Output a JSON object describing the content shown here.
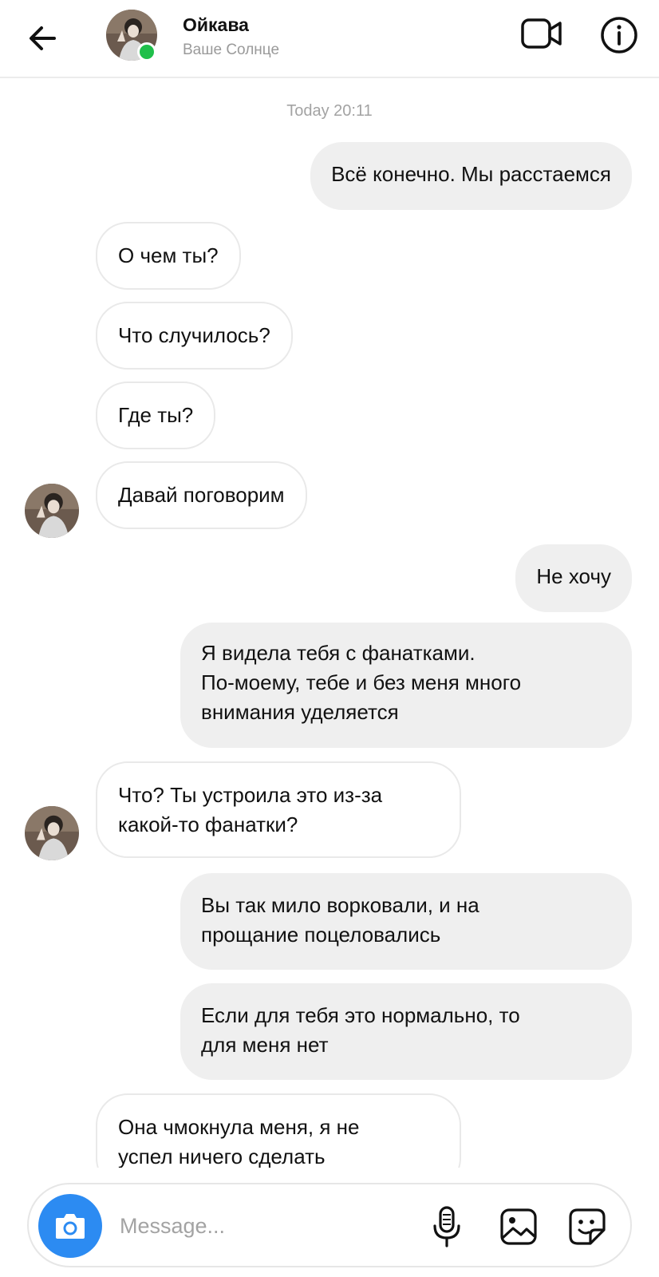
{
  "header": {
    "contact_name": "Ойкава",
    "contact_status": "Ваше Солнце",
    "back_icon": "arrow-left-icon",
    "video_icon": "video-camera-icon",
    "info_icon": "info-icon",
    "online_color": "#1fbf4a"
  },
  "chat": {
    "timestamp": "Today 20:11",
    "messages": [
      {
        "direction": "outgoing",
        "text": "Всё конечно. Мы расстаемся"
      },
      {
        "direction": "incoming",
        "text": "О чем ты?"
      },
      {
        "direction": "incoming",
        "text": "Что случилось?"
      },
      {
        "direction": "incoming",
        "text": "Где ты?"
      },
      {
        "direction": "incoming",
        "text": "Давай поговорим"
      },
      {
        "direction": "outgoing",
        "text": "Не хочу"
      },
      {
        "direction": "outgoing",
        "text": "Я видела тебя с фанатками.\nПо-моему, тебе и без меня много\nвнимания уделяется"
      },
      {
        "direction": "incoming",
        "text": "Что? Ты устроила это из-за\nкакой-то фанатки?"
      },
      {
        "direction": "outgoing",
        "text": "Вы так мило ворковали, и на\nпрощание поцеловались"
      },
      {
        "direction": "outgoing",
        "text": "Если для тебя это нормально, то\nдля меня нет"
      },
      {
        "direction": "incoming",
        "text": "Она чмокнула меня, я не\nуспел ничего сделать"
      }
    ]
  },
  "composer": {
    "placeholder": "Message...",
    "camera_icon": "camera-icon",
    "mic_icon": "microphone-icon",
    "gallery_icon": "image-gallery-icon",
    "sticker_icon": "sticker-icon",
    "camera_color": "#2c8bf2"
  }
}
